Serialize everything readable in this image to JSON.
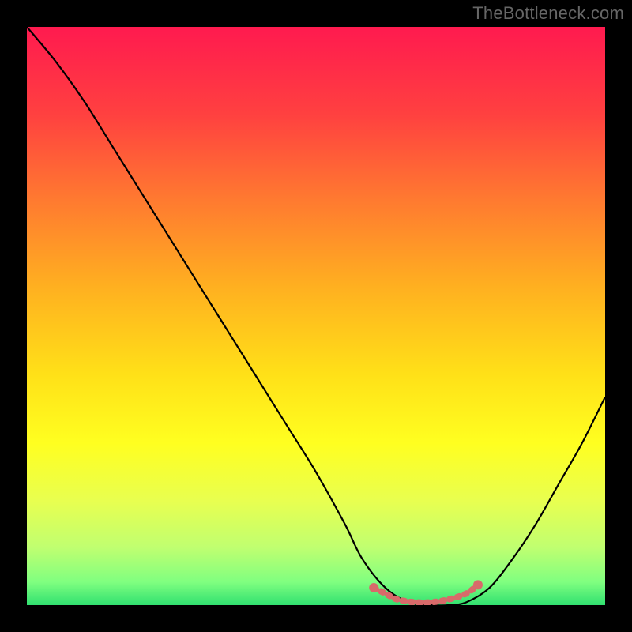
{
  "watermark": "TheBottleneck.com",
  "chart_data": {
    "type": "line",
    "title": "",
    "xlabel": "",
    "ylabel": "",
    "xlim": [
      0,
      100
    ],
    "ylim": [
      0,
      100
    ],
    "grid": false,
    "legend": false,
    "series": [
      {
        "name": "bottleneck-curve",
        "x": [
          0,
          5,
          10,
          15,
          20,
          25,
          30,
          35,
          40,
          45,
          50,
          55,
          58,
          62,
          66,
          70,
          73,
          76,
          80,
          84,
          88,
          92,
          96,
          100
        ],
        "y": [
          100,
          94,
          87,
          79,
          71,
          63,
          55,
          47,
          39,
          31,
          23,
          14,
          8,
          3,
          0.5,
          0,
          0,
          0.5,
          3,
          8,
          14,
          21,
          28,
          36
        ]
      },
      {
        "name": "valley-marker",
        "x": [
          60,
          62,
          64,
          67,
          70,
          73,
          76,
          78
        ],
        "y": [
          3,
          2,
          1,
          0.5,
          0.5,
          1,
          2,
          3.5
        ]
      }
    ],
    "gradient_stops": [
      {
        "offset": 0.0,
        "color": "#ff1a4f"
      },
      {
        "offset": 0.15,
        "color": "#ff4040"
      },
      {
        "offset": 0.3,
        "color": "#ff7a30"
      },
      {
        "offset": 0.45,
        "color": "#ffb020"
      },
      {
        "offset": 0.6,
        "color": "#ffe018"
      },
      {
        "offset": 0.72,
        "color": "#ffff20"
      },
      {
        "offset": 0.82,
        "color": "#e8ff50"
      },
      {
        "offset": 0.9,
        "color": "#c0ff70"
      },
      {
        "offset": 0.96,
        "color": "#80ff80"
      },
      {
        "offset": 1.0,
        "color": "#30e070"
      }
    ],
    "colors": {
      "curve": "#000000",
      "marker": "#d86a6a",
      "frame": "#000000"
    }
  }
}
